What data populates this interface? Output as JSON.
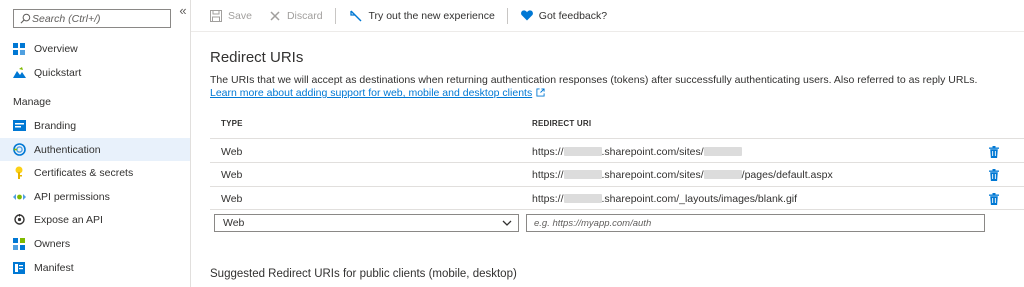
{
  "sidebar": {
    "search_placeholder": "Search (Ctrl+/)",
    "collapse_glyph": "«",
    "top_items": [
      {
        "label": "Overview",
        "icon": "overview-icon"
      },
      {
        "label": "Quickstart",
        "icon": "quickstart-icon"
      }
    ],
    "section_label": "Manage",
    "manage_items": [
      {
        "label": "Branding",
        "icon": "branding-icon"
      },
      {
        "label": "Authentication",
        "icon": "authentication-icon",
        "active": true
      },
      {
        "label": "Certificates & secrets",
        "icon": "key-icon"
      },
      {
        "label": "API permissions",
        "icon": "api-permissions-icon"
      },
      {
        "label": "Expose an API",
        "icon": "cloud-icon"
      },
      {
        "label": "Owners",
        "icon": "owners-icon"
      },
      {
        "label": "Manifest",
        "icon": "manifest-icon"
      }
    ]
  },
  "toolbar": {
    "save_label": "Save",
    "discard_label": "Discard",
    "try_label": "Try out the new experience",
    "feedback_label": "Got feedback?"
  },
  "redirect": {
    "heading": "Redirect URIs",
    "description": "The URIs that we will accept as destinations when returning authentication responses (tokens) after successfully authenticating users. Also referred to as reply URLs.",
    "learn_more": "Learn more about adding support for web, mobile and desktop clients",
    "col_type": "TYPE",
    "col_uri": "REDIRECT URI",
    "rows": [
      {
        "type": "Web",
        "uri_prefix": "https://",
        "uri_mid": ".sharepoint.com/sites/",
        "uri_suffix": ""
      },
      {
        "type": "Web",
        "uri_prefix": "https://",
        "uri_mid": ".sharepoint.com/sites/",
        "uri_suffix": "/pages/default.aspx"
      },
      {
        "type": "Web",
        "uri_prefix": "https://",
        "uri_mid": ".sharepoint.com/_layouts/images/blank.gif",
        "uri_suffix": ""
      }
    ],
    "new_row": {
      "type_value": "Web",
      "uri_placeholder": "e.g. https://myapp.com/auth"
    }
  },
  "suggested": {
    "heading": "Suggested Redirect URIs for public clients (mobile, desktop)"
  },
  "colors": {
    "accent": "#0078d4",
    "active_bg": "#e8f1fb",
    "heart": "#0078d4"
  }
}
